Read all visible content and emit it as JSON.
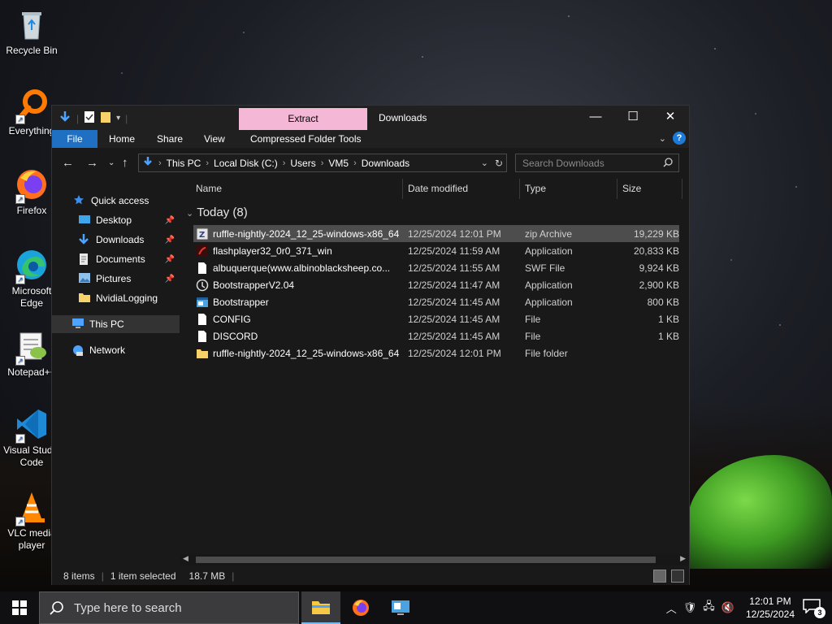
{
  "desktop": {
    "icons": [
      {
        "label": "Recycle Bin"
      },
      {
        "label": "Everything"
      },
      {
        "label": "Firefox"
      },
      {
        "label": "Microsoft Edge"
      },
      {
        "label": "Notepad++"
      },
      {
        "label": "Visual Studio Code"
      },
      {
        "label": "VLC media player"
      }
    ]
  },
  "window": {
    "context_tab": "Extract",
    "title": "Downloads",
    "ribbon": {
      "file": "File",
      "home": "Home",
      "share": "Share",
      "view": "View",
      "tools": "Compressed Folder Tools"
    },
    "address": {
      "crumbs": [
        "This PC",
        "Local Disk (C:)",
        "Users",
        "VM5",
        "Downloads"
      ]
    },
    "search_placeholder": "Search Downloads",
    "nav": {
      "quick_access": "Quick access",
      "desktop": "Desktop",
      "downloads": "Downloads",
      "documents": "Documents",
      "pictures": "Pictures",
      "nvidialogging": "NvidiaLogging",
      "this_pc": "This PC",
      "network": "Network"
    },
    "columns": {
      "name": "Name",
      "date": "Date modified",
      "type": "Type",
      "size": "Size"
    },
    "group": "Today (8)",
    "files": [
      {
        "name": "ruffle-nightly-2024_12_25-windows-x86_64",
        "date": "12/25/2024 12:01 PM",
        "type": "zip Archive",
        "size": "19,229 KB"
      },
      {
        "name": "flashplayer32_0r0_371_win",
        "date": "12/25/2024 11:59 AM",
        "type": "Application",
        "size": "20,833 KB"
      },
      {
        "name": "albuquerque(www.albinoblacksheep.co...",
        "date": "12/25/2024 11:55 AM",
        "type": "SWF File",
        "size": "9,924 KB"
      },
      {
        "name": "BootstrapperV2.04",
        "date": "12/25/2024 11:47 AM",
        "type": "Application",
        "size": "2,900 KB"
      },
      {
        "name": "Bootstrapper",
        "date": "12/25/2024 11:45 AM",
        "type": "Application",
        "size": "800 KB"
      },
      {
        "name": "CONFIG",
        "date": "12/25/2024 11:45 AM",
        "type": "File",
        "size": "1 KB"
      },
      {
        "name": "DISCORD",
        "date": "12/25/2024 11:45 AM",
        "type": "File",
        "size": "1 KB"
      },
      {
        "name": "ruffle-nightly-2024_12_25-windows-x86_64",
        "date": "12/25/2024 12:01 PM",
        "type": "File folder",
        "size": ""
      }
    ],
    "status": {
      "items": "8 items",
      "selected": "1 item selected",
      "size": "18.7 MB"
    }
  },
  "taskbar": {
    "search_placeholder": "Type here to search",
    "time": "12:01 PM",
    "date": "12/25/2024",
    "notification_count": "3"
  }
}
